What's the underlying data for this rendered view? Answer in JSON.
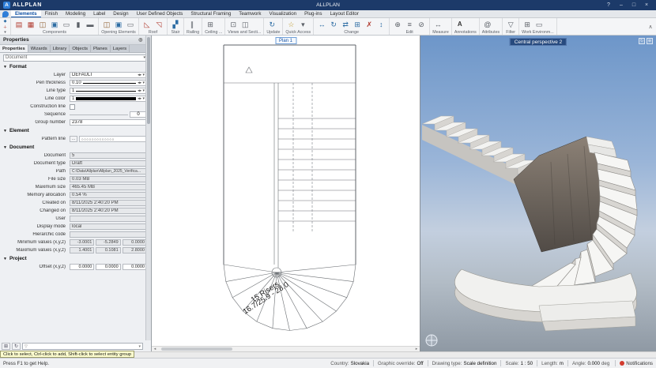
{
  "title_bar": {
    "app_name": "ALLPLAN",
    "window_title": "ALLPLAN",
    "help_label": "?",
    "minimize_label": "–",
    "maximize_label": "□",
    "close_label": "×"
  },
  "menu": {
    "items": [
      "Elements",
      "Finish",
      "Modeling",
      "Label",
      "Design",
      "User Defined Objects",
      "Structural Framing",
      "Teamwork",
      "Visualization",
      "Plug-ins",
      "Layout Editor"
    ]
  },
  "ribbon": {
    "groups": [
      {
        "label": "Components"
      },
      {
        "label": "Opening Elements"
      },
      {
        "label": "Roof"
      },
      {
        "label": "Stair"
      },
      {
        "label": "Railing"
      },
      {
        "label": "Ceiling ..."
      },
      {
        "label": "Views and Secti..."
      },
      {
        "label": "Update"
      },
      {
        "label": "Quick Access"
      },
      {
        "label": "Change"
      },
      {
        "label": "Edit"
      },
      {
        "label": "Measure"
      },
      {
        "label": "Annotations"
      },
      {
        "label": "Attributes"
      },
      {
        "label": "Filter"
      },
      {
        "label": "Work Environm..."
      }
    ]
  },
  "panel": {
    "title": "Properties",
    "tabs": [
      "Properties",
      "Wizards",
      "Library",
      "Objects",
      "Planes",
      "Layers"
    ],
    "selector_value": "Document",
    "format": {
      "title": "Format",
      "layer_label": "Layer",
      "layer_value": "DEFAULT",
      "pen_label": "Pen thickness",
      "pen_value": "0.10",
      "linetype_label": "Line type",
      "linetype_value": "1",
      "linecolor_label": "Line color",
      "linecolor_value": "1",
      "construction_label": "Construction line",
      "sequence_label": "Sequence",
      "sequence_value": "0",
      "group_label": "Group number",
      "group_value": "2378"
    },
    "element": {
      "title": "Element",
      "pattern_label": "Pattern line",
      "pattern_button": "…",
      "pattern_preview": "○○○○○○○○○○○○○"
    },
    "document": {
      "title": "Document",
      "rows": [
        {
          "label": "Document",
          "value": "5"
        },
        {
          "label": "Document type",
          "value": "Draft"
        },
        {
          "label": "Path",
          "value": "C:\\Data\\Allplan\\Allplan_2025_Verifica..."
        },
        {
          "label": "File size",
          "value": "0.03 MB"
        },
        {
          "label": "Maximum size",
          "value": "465.45 MB"
        },
        {
          "label": "Memory allocation",
          "value": "0.54 %"
        },
        {
          "label": "Created on",
          "value": "8/11/2025 2:40:20 PM"
        },
        {
          "label": "Changed on",
          "value": "8/11/2025 2:40:20 PM"
        },
        {
          "label": "User",
          "value": ""
        },
        {
          "label": "Display mode",
          "value": "local"
        }
      ],
      "hierarchic_label": "Hierarchic code",
      "min_label": "Minimum values (x,y,z)",
      "min_x": "-3.0001",
      "min_y": "-5.2849",
      "min_z": "0.0000",
      "max_label": "Maximum values (x,y,z)",
      "max_x": "1.4001",
      "max_y": "0.1081",
      "max_z": "2.8000"
    },
    "project": {
      "title": "Project",
      "offset_label": "Offset (x,y,z)",
      "offset_x": "0.0000",
      "offset_y": "0.0000",
      "offset_z": "0.0000"
    }
  },
  "plan_view": {
    "label": "Plan 1",
    "risers_text_1": "15 Risers",
    "risers_text_2": "16.7/25.9 - 28.0"
  },
  "perspective_view": {
    "label": "Central perspective 2"
  },
  "status": {
    "tooltip": "Click to select, Ctrl-click to add, Shift-click to select entity group",
    "help": "Press F1 to get Help.",
    "country_label": "Country:",
    "country_value": "Slovakia",
    "override_label": "Graphic override:",
    "override_value": "Off",
    "drawing_label": "Drawing type:",
    "drawing_value": "Scale definition",
    "scale_label": "Scale:",
    "scale_value": "1 : 50",
    "length_label": "Length:",
    "length_value": "m",
    "angle_label": "Angle:",
    "angle_value": "0.000",
    "angle_unit": "deg",
    "notifications": "Notifications"
  }
}
